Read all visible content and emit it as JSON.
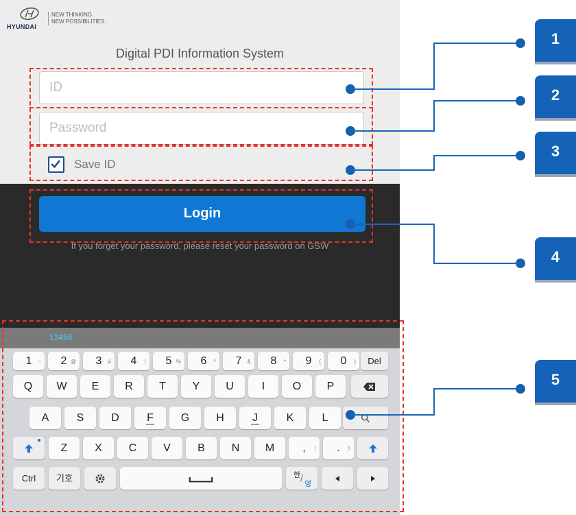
{
  "header": {
    "brand": "HYUNDAI",
    "tagline_1": "NEW THINKING.",
    "tagline_2": "NEW POSSIBILITIES.",
    "system_title": "Digital PDI Information System"
  },
  "login_form": {
    "id_placeholder": "ID",
    "password_placeholder": "Password",
    "save_id_label": "Save ID",
    "save_id_checked": true,
    "login_label": "Login",
    "forgot_text": "If you forget your password, please reset your password on GSW"
  },
  "keyboard": {
    "suggestion": "13456",
    "row1": [
      {
        "main": "1",
        "sup": "~"
      },
      {
        "main": "2",
        "sup": "@"
      },
      {
        "main": "3",
        "sup": "#"
      },
      {
        "main": "4",
        "sup": "/"
      },
      {
        "main": "5",
        "sup": "%"
      },
      {
        "main": "6",
        "sup": "^"
      },
      {
        "main": "7",
        "sup": "&"
      },
      {
        "main": "8",
        "sup": "*"
      },
      {
        "main": "9",
        "sup": "("
      },
      {
        "main": "0",
        "sup": ")"
      }
    ],
    "del_label": "Del",
    "row2": [
      "Q",
      "W",
      "E",
      "R",
      "T",
      "Y",
      "U",
      "I",
      "O",
      "P"
    ],
    "row3": [
      "A",
      "S",
      "D",
      "F",
      "G",
      "H",
      "J",
      "K",
      "L"
    ],
    "row4": [
      {
        "main": "Z"
      },
      {
        "main": "X"
      },
      {
        "main": "C"
      },
      {
        "main": "V"
      },
      {
        "main": "B"
      },
      {
        "main": "N"
      },
      {
        "main": "M"
      },
      {
        "main": ",",
        "sup": "!"
      },
      {
        "main": ".",
        "sup": "?"
      }
    ],
    "ctrl_label": "Ctrl",
    "symbol_label": "기호",
    "lang_top": "한",
    "lang_bottom": "영"
  },
  "callouts": [
    "1",
    "2",
    "3",
    "4",
    "5"
  ],
  "colors": {
    "accent": "#1077d4",
    "callout": "#1463b8",
    "highlight": "#e8322a"
  }
}
